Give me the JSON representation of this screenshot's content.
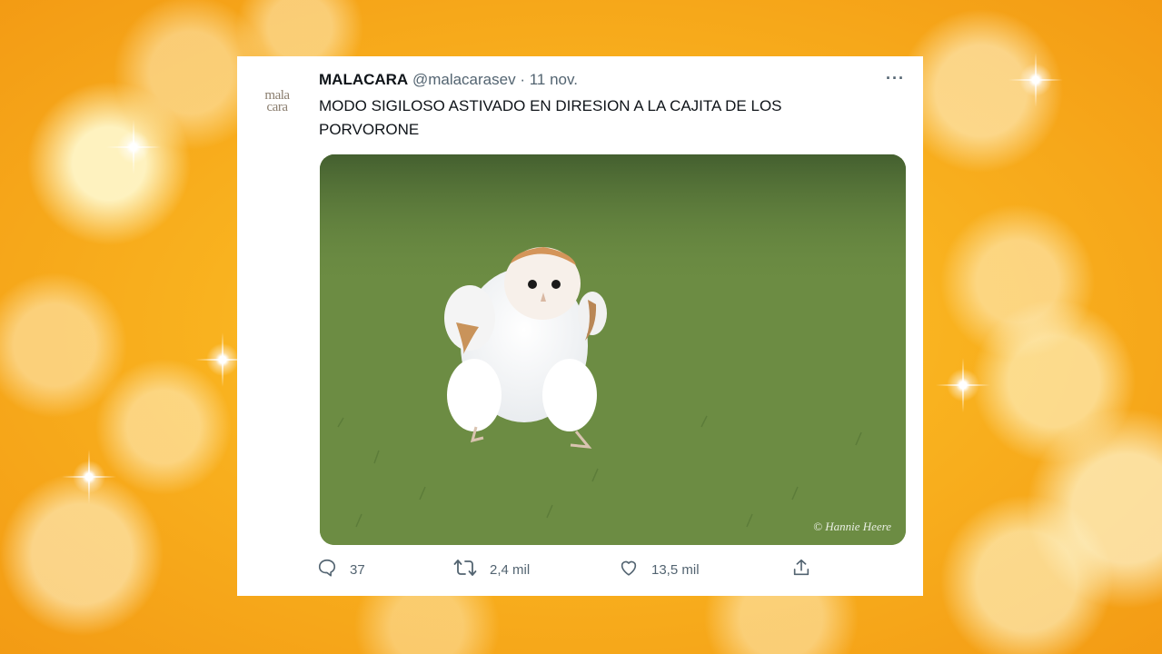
{
  "tweet": {
    "display_name": "MALACARA",
    "handle": "@malacarasev",
    "date": "· 11 nov.",
    "avatar_line1": "mala",
    "avatar_line2": "cara",
    "more_label": "···",
    "text": "MODO SIGILOSO ASTIVADO EN DIRESION A LA CAJITA DE LOS PORVORONE",
    "photo_credit": "© Hannie Heere",
    "replies": "37",
    "retweets": "2,4 mil",
    "likes": "13,5 mil"
  },
  "icons": {
    "reply": "reply-icon",
    "retweet": "retweet-icon",
    "like": "heart-icon",
    "share": "share-icon",
    "more": "more-icon"
  },
  "colors": {
    "background": "#f9b21f",
    "card": "#ffffff",
    "text": "#0f1419",
    "muted": "#536471"
  }
}
